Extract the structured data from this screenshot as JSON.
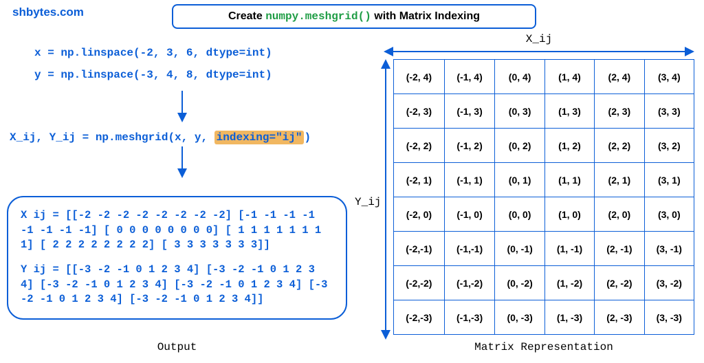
{
  "site": "shbytes.com",
  "title": {
    "pre": "Create ",
    "func": "numpy.meshgrid()",
    "post": " with Matrix Indexing"
  },
  "code": {
    "x": "x = np.linspace(-2, 3, 6, dtype=int)",
    "y": "y = np.linspace(-3, 4, 8, dtype=int)",
    "mesh_pre": "X_ij, Y_ij = np.meshgrid(x, y, ",
    "mesh_hl": "indexing=\"ij\"",
    "mesh_post": ")"
  },
  "output": {
    "x_text": "X ij = [[-2 -2 -2 -2 -2 -2 -2 -2] [-1 -1 -1 -1 -1 -1 -1 -1] [ 0 0 0 0 0 0 0 0] [ 1 1 1 1 1 1 1 1] [ 2 2 2 2 2 2 2 2] [ 3 3 3 3 3 3 3]]",
    "y_text": "Y ij = [[-3 -2 -1 0 1 2 3 4] [-3 -2 -1 0 1 2 3 4] [-3 -2 -1 0 1 2 3 4] [-3 -2 -1 0 1 2 3 4] [-3 -2 -1 0 1 2 3 4] [-3 -2 -1 0 1 2 3 4]]",
    "label": "Output"
  },
  "axis": {
    "x_label": "X_ij",
    "y_label": "Y_ij",
    "matrix_label": "Matrix Representation"
  },
  "grid": {
    "rows": [
      [
        "(-2, 4)",
        "(-1, 4)",
        "(0, 4)",
        "(1, 4)",
        "(2, 4)",
        "(3, 4)"
      ],
      [
        "(-2, 3)",
        "(-1, 3)",
        "(0, 3)",
        "(1, 3)",
        "(2, 3)",
        "(3, 3)"
      ],
      [
        "(-2, 2)",
        "(-1, 2)",
        "(0, 2)",
        "(1, 2)",
        "(2, 2)",
        "(3, 2)"
      ],
      [
        "(-2, 1)",
        "(-1, 1)",
        "(0, 1)",
        "(1, 1)",
        "(2, 1)",
        "(3, 1)"
      ],
      [
        "(-2, 0)",
        "(-1, 0)",
        "(0, 0)",
        "(1, 0)",
        "(2, 0)",
        "(3, 0)"
      ],
      [
        "(-2,-1)",
        "(-1,-1)",
        "(0, -1)",
        "(1, -1)",
        "(2, -1)",
        "(3, -1)"
      ],
      [
        "(-2,-2)",
        "(-1,-2)",
        "(0, -2)",
        "(1, -2)",
        "(2, -2)",
        "(3, -2)"
      ],
      [
        "(-2,-3)",
        "(-1,-3)",
        "(0, -3)",
        "(1, -3)",
        "(2, -3)",
        "(3, -3)"
      ]
    ]
  }
}
